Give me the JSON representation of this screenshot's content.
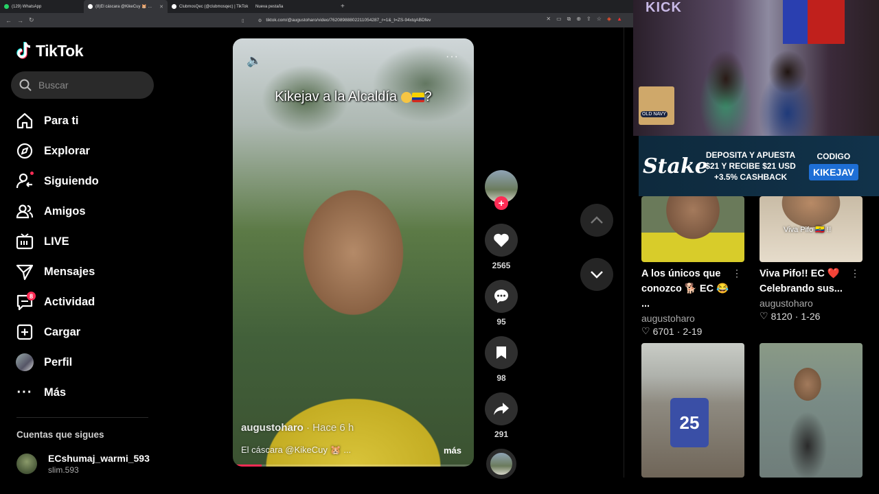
{
  "browser": {
    "tabs": [
      {
        "label": "(129) WhatsApp",
        "color": "#25d366",
        "active": false
      },
      {
        "label": "(8)El cáscara @KikeCuy 🐹 …",
        "color": "#ffffff",
        "active": true
      },
      {
        "label": "ClubmosQec (@clubmosqec) | TikTok",
        "color": "#ffffff",
        "active": false
      },
      {
        "label": "Nueva pestaña",
        "color": "",
        "active": false
      }
    ],
    "url": "tiktok.com/@augustoharo/video/7620898880221105428​7_r=1&_t=ZS-94xtqABDfev"
  },
  "sidebar": {
    "logo": "TikTok",
    "search_placeholder": "Buscar",
    "nav": [
      {
        "label": "Para ti",
        "icon": "home-icon"
      },
      {
        "label": "Explorar",
        "icon": "compass-icon"
      },
      {
        "label": "Siguiendo",
        "icon": "following-icon",
        "dot": true
      },
      {
        "label": "Amigos",
        "icon": "friends-icon"
      },
      {
        "label": "LIVE",
        "icon": "live-icon"
      },
      {
        "label": "Mensajes",
        "icon": "messages-icon"
      },
      {
        "label": "Actividad",
        "icon": "activity-icon",
        "badge": "8"
      },
      {
        "label": "Cargar",
        "icon": "upload-icon"
      },
      {
        "label": "Perfil",
        "icon": "profile-avatar"
      },
      {
        "label": "Más",
        "icon": "more-icon"
      }
    ],
    "following_title": "Cuentas que sigues",
    "account": {
      "name": "ECshumaj_warmi_593",
      "handle": "slim.593"
    }
  },
  "video": {
    "caption": "Kikejav  a la Alcaldía",
    "caption_end": "?",
    "author": "augustoharo",
    "time": " · Hace 6 h",
    "description": "El cáscara @KikeCuy 🐹 ...",
    "more": "más",
    "progress": 0.12
  },
  "actions": {
    "likes": "2565",
    "comments": "95",
    "saves": "98",
    "shares": "291"
  },
  "stream": {
    "kick": "KICK",
    "bag_text": "OLD NAVY",
    "stake": "Stake",
    "promo_line1": "DEPOSITA Y APUESTA",
    "promo_line2": "$21 Y  RECIBE $21 USD",
    "promo_line3": "+3.5% CASHBACK",
    "code_label": "CODIGO",
    "code_value": "KIKEJAV"
  },
  "grid": [
    {
      "title": "A los únicos que conozco 🐕 EC 😂 ...",
      "user": "augustoharo",
      "likes": "6701",
      "date": "2-19"
    },
    {
      "title": "Viva Pifo!! EC ❤️ Celebrando sus...",
      "user": "augustoharo",
      "likes": "8120",
      "date": "1-26",
      "overlay": "Viva Pifo 🇪🇨 !!"
    },
    {
      "title": "",
      "user": "",
      "likes": "",
      "date": "",
      "jersey": "25"
    },
    {
      "title": "",
      "user": "",
      "likes": "",
      "date": ""
    }
  ],
  "colors": {
    "accent": "#fe2c55",
    "bg": "#000000",
    "panel": "#2f2f2f"
  }
}
